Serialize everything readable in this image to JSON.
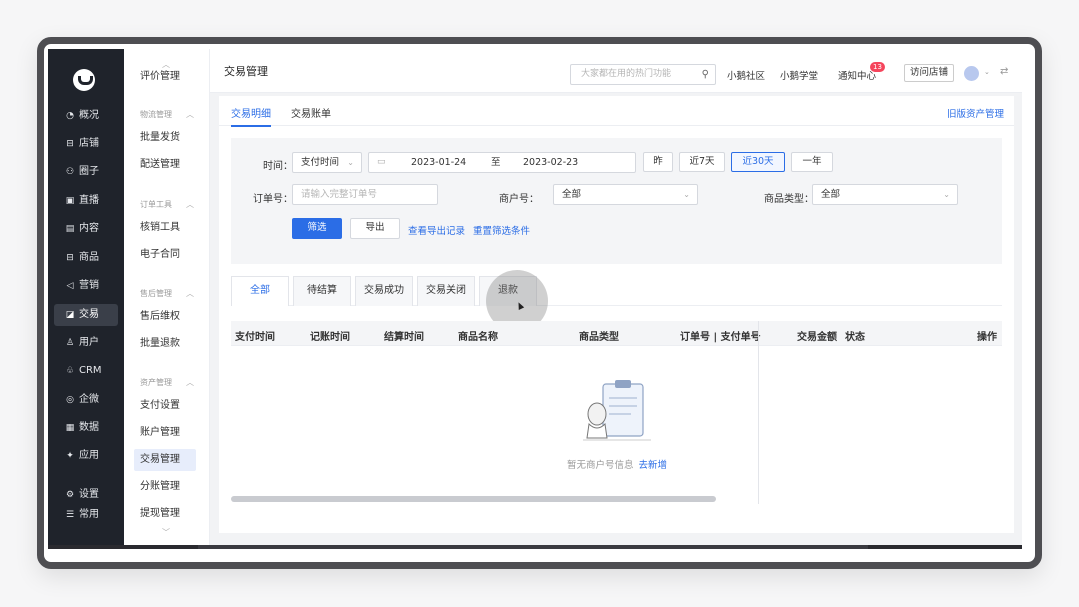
{
  "sidebar": {
    "items": [
      {
        "icon": "◔",
        "icon_name": "overview-icon",
        "label": "概况"
      },
      {
        "icon": "⊟",
        "icon_name": "store-icon",
        "label": "店铺"
      },
      {
        "icon": "⚇",
        "icon_name": "circle-icon",
        "label": "圈子"
      },
      {
        "icon": "▣",
        "icon_name": "live-icon",
        "label": "直播"
      },
      {
        "icon": "▤",
        "icon_name": "content-icon",
        "label": "内容"
      },
      {
        "icon": "⊟",
        "icon_name": "goods-icon",
        "label": "商品"
      },
      {
        "icon": "◁",
        "icon_name": "marketing-icon",
        "label": "营销"
      },
      {
        "icon": "◪",
        "icon_name": "trade-icon",
        "label": "交易"
      },
      {
        "icon": "♙",
        "icon_name": "user-icon",
        "label": "用户"
      },
      {
        "icon": "♧",
        "icon_name": "crm-icon",
        "label": "CRM"
      },
      {
        "icon": "◎",
        "icon_name": "wecom-icon",
        "label": "企微"
      },
      {
        "icon": "▦",
        "icon_name": "data-icon",
        "label": "数据"
      },
      {
        "icon": "✦",
        "icon_name": "apps-icon",
        "label": "应用"
      },
      {
        "icon": "⚙",
        "icon_name": "settings-icon",
        "label": "设置"
      },
      {
        "icon": "☰",
        "icon_name": "common-icon",
        "label": "常用"
      }
    ]
  },
  "submenu": {
    "top_item": "评价管理",
    "groups": [
      {
        "title": "物流管理",
        "items": [
          "批量发货",
          "配送管理"
        ]
      },
      {
        "title": "订单工具",
        "items": [
          "核销工具",
          "电子合同"
        ]
      },
      {
        "title": "售后管理",
        "items": [
          "售后维权",
          "批量退款"
        ]
      },
      {
        "title": "资产管理",
        "items": [
          "支付设置",
          "账户管理",
          "交易管理",
          "分账管理",
          "提现管理"
        ]
      }
    ]
  },
  "header": {
    "title": "交易管理",
    "search_placeholder": "大家都在用的热门功能",
    "links": [
      "小鹅社区",
      "小鹅学堂",
      "通知中心"
    ],
    "notification_count": "13",
    "visit_store": "访问店铺"
  },
  "main": {
    "tabs": [
      "交易明细",
      "交易账单"
    ],
    "old_link": "旧版资产管理",
    "filter": {
      "time_label": "时间：",
      "time_type": "支付时间",
      "start_date": "2023-01-24",
      "date_sep": "至",
      "end_date": "2023-02-23",
      "quick": [
        "昨",
        "近7天",
        "近30天",
        "一年"
      ],
      "order_label": "订单号：",
      "order_placeholder": "请输入完整订单号",
      "merchant_label": "商户号：",
      "merchant_value": "全部",
      "goods_type_label": "商品类型：",
      "goods_type_value": "全部",
      "filter_btn": "筛选",
      "export_btn": "导出",
      "view_export": "查看导出记录",
      "reset": "重置筛选条件"
    },
    "status_tabs": [
      "全部",
      "待结算",
      "交易成功",
      "交易关闭",
      "退款"
    ],
    "columns": [
      "支付时间",
      "记账时间",
      "结算时间",
      "商品名称",
      "商品类型",
      "订单号 | 支付单号",
      "交易金额",
      "状态",
      "操作"
    ],
    "empty_text": "暂无商户号信息",
    "empty_link": "去新增"
  },
  "colors": {
    "accent": "#2b6de6",
    "sidebar_bg": "#1f232b"
  }
}
